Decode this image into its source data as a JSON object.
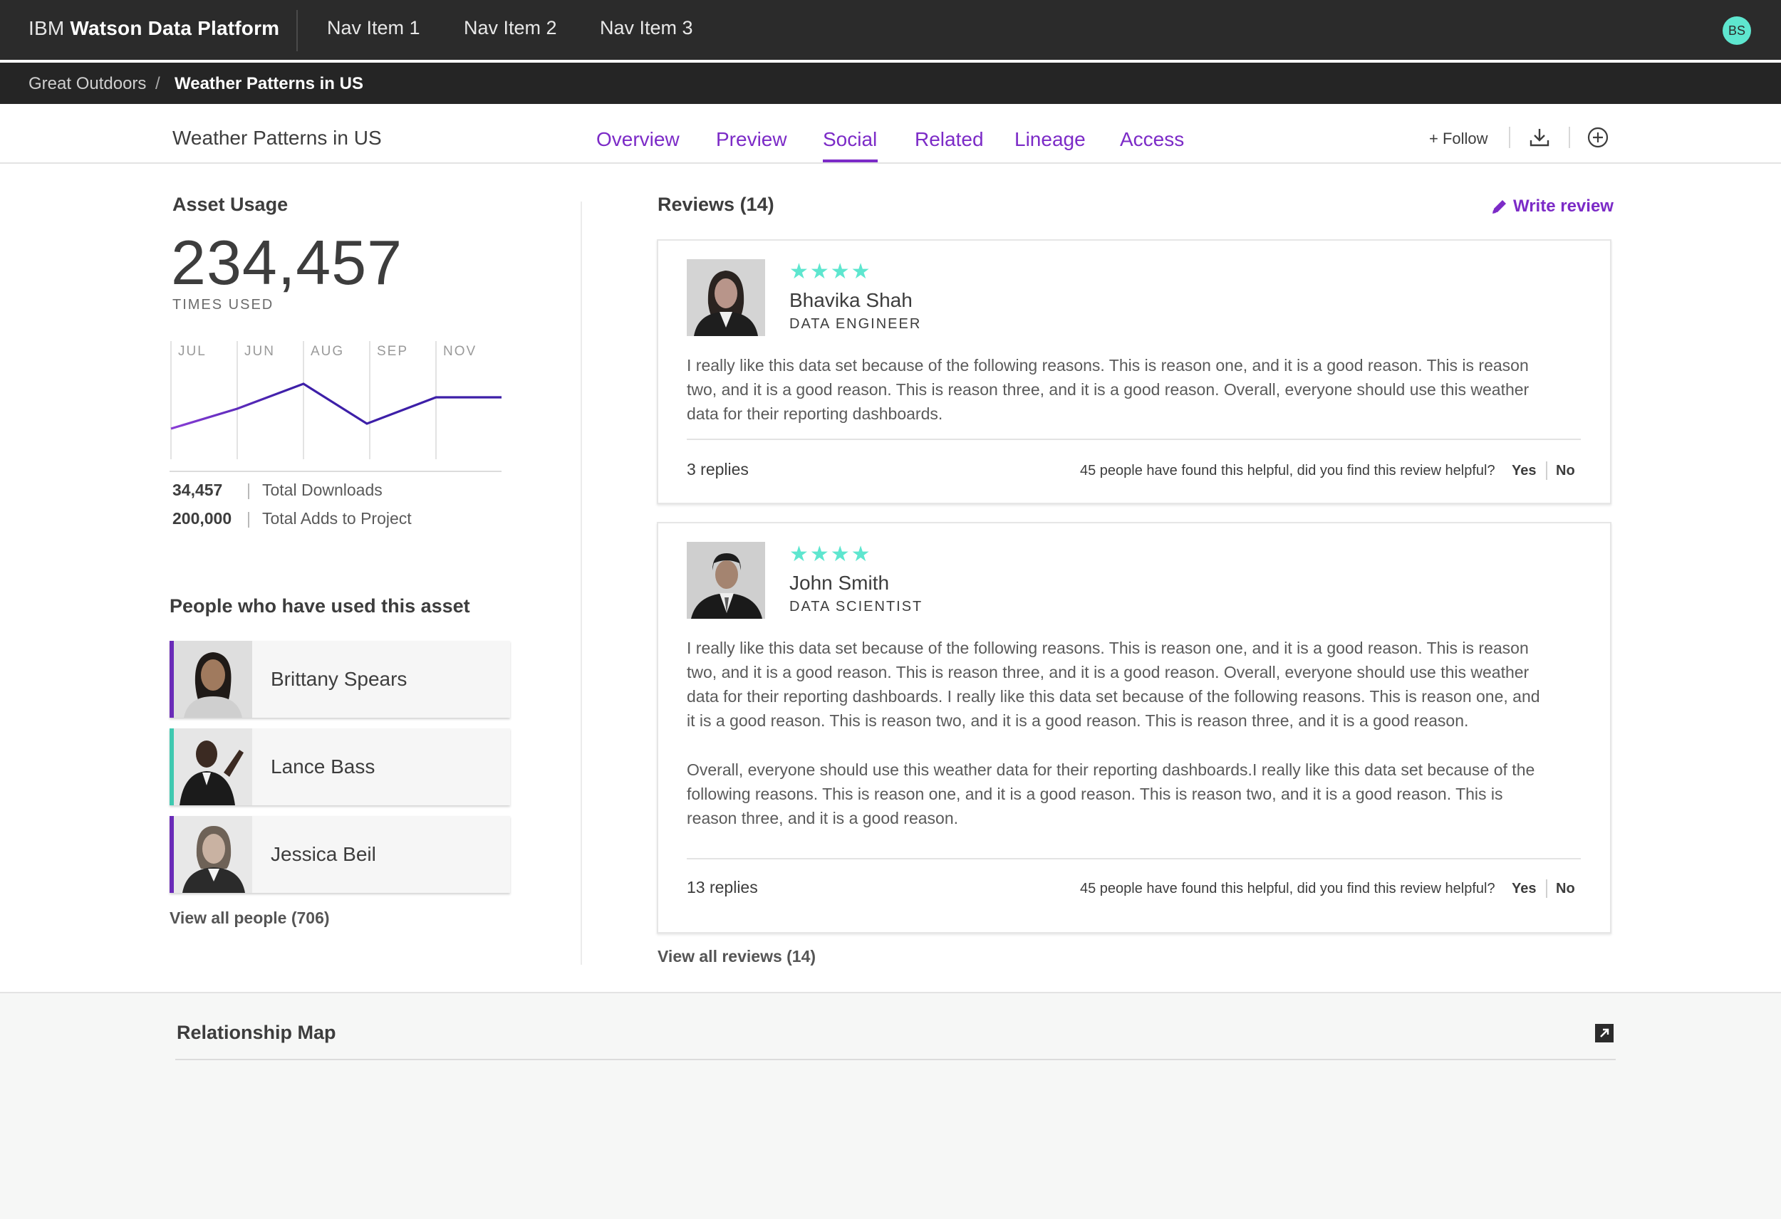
{
  "topnav": {
    "brand_prefix": "IBM",
    "brand_name": "Watson Data Platform",
    "items": [
      {
        "label": "Nav Item 1"
      },
      {
        "label": "Nav Item 2"
      },
      {
        "label": "Nav Item 3"
      }
    ],
    "user_initials": "BS"
  },
  "breadcrumb": {
    "parent": "Great Outdoors",
    "separator": "/",
    "current": "Weather Patterns in US"
  },
  "asset_header": {
    "title": "Weather Patterns in US",
    "tabs": [
      {
        "label": "Overview",
        "active": false
      },
      {
        "label": "Preview",
        "active": false
      },
      {
        "label": "Social",
        "active": true
      },
      {
        "label": "Related",
        "active": false
      },
      {
        "label": "Lineage",
        "active": false
      },
      {
        "label": "Access",
        "active": false
      }
    ],
    "follow_label": "+ Follow",
    "icons": [
      "download-icon",
      "add-circle-icon"
    ]
  },
  "asset_usage": {
    "heading": "Asset Usage",
    "times_used_value": "234,457",
    "times_used_label": "TIMES USED",
    "stats": [
      {
        "value": "34,457",
        "label": "Total Downloads"
      },
      {
        "value": "200,000",
        "label": "Total Adds to Project"
      }
    ]
  },
  "usage_chart": {
    "months": [
      "JUL",
      "JUN",
      "AUG",
      "SEP",
      "NOV"
    ],
    "line_color": "#3d1fa8",
    "line_start_color": "#8a3ed6"
  },
  "people": {
    "heading": "People who have used this asset",
    "items": [
      {
        "name": "Brittany Spears",
        "accent": "#6a2bb8"
      },
      {
        "name": "Lance Bass",
        "accent": "#3fc9b0"
      },
      {
        "name": "Jessica Beil",
        "accent": "#6a2bb8"
      }
    ],
    "view_all": "View all people (706)"
  },
  "reviews": {
    "heading": "Reviews (14)",
    "write_review": "Write review",
    "items": [
      {
        "rating": 4,
        "stars": "★★★★",
        "name": "Bhavika Shah",
        "role": "DATA ENGINEER",
        "text_paragraphs": [
          "I really like this data set because of the following reasons. This is reason one, and it is a good reason. This is reason two, and it is a good reason. This is reason three, and it is a good reason. Overall, everyone should use this weather data for their reporting dashboards."
        ],
        "replies": "3 replies",
        "helpful_text": "45 people have found this helpful, did you find this review helpful?",
        "yes": "Yes",
        "no": "No"
      },
      {
        "rating": 4,
        "stars": "★★★★",
        "name": "John Smith",
        "role": "DATA SCIENTIST",
        "text_paragraphs": [
          "I really like this data set because of the following reasons. This is reason one, and it is a good reason. This is reason two, and it is a good reason. This is reason three, and it is a good reason. Overall, everyone should use this weather data for their reporting dashboards. I really like this data set because of the following reasons. This is reason one, and it is a good reason. This is reason two, and it is a good reason. This is reason three, and it is a good reason.",
          "Overall, everyone should use this weather data for their reporting dashboards.I really like this data set because of the following reasons. This is reason one, and it is a good reason. This is reason two, and it is a good reason. This is reason three, and it is a good reason."
        ],
        "replies": "13 replies",
        "helpful_text": "45 people have found this helpful, did you find this review helpful?",
        "yes": "Yes",
        "no": "No"
      }
    ],
    "view_all": "View all reviews (14)"
  },
  "relationship_map": {
    "heading": "Relationship Map",
    "icon": "expand-icon"
  },
  "colors": {
    "accent_purple": "#7c2bc7",
    "star_teal": "#5ee6cf",
    "topnav_bg": "#2b2b2b"
  }
}
